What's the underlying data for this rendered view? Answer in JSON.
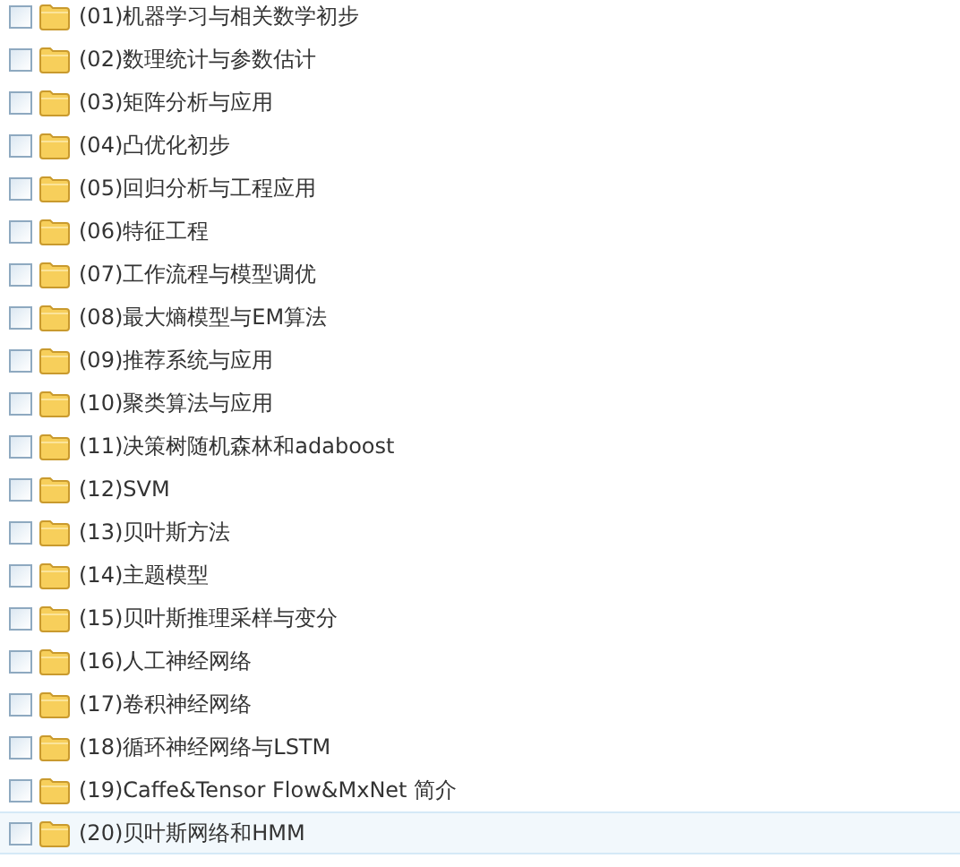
{
  "folders": [
    {
      "name": "(01)机器学习与相关数学初步",
      "highlighted": false
    },
    {
      "name": "(02)数理统计与参数估计",
      "highlighted": false
    },
    {
      "name": "(03)矩阵分析与应用",
      "highlighted": false
    },
    {
      "name": "(04)凸优化初步",
      "highlighted": false
    },
    {
      "name": "(05)回归分析与工程应用",
      "highlighted": false
    },
    {
      "name": "(06)特征工程",
      "highlighted": false
    },
    {
      "name": "(07)工作流程与模型调优",
      "highlighted": false
    },
    {
      "name": "(08)最大熵模型与EM算法",
      "highlighted": false
    },
    {
      "name": "(09)推荐系统与应用",
      "highlighted": false
    },
    {
      "name": "(10)聚类算法与应用",
      "highlighted": false
    },
    {
      "name": "(11)决策树随机森林和adaboost",
      "highlighted": false
    },
    {
      "name": "(12)SVM",
      "highlighted": false
    },
    {
      "name": "(13)贝叶斯方法",
      "highlighted": false
    },
    {
      "name": "(14)主题模型",
      "highlighted": false
    },
    {
      "name": "(15)贝叶斯推理采样与变分",
      "highlighted": false
    },
    {
      "name": "(16)人工神经网络",
      "highlighted": false
    },
    {
      "name": "(17)卷积神经网络",
      "highlighted": false
    },
    {
      "name": "(18)循环神经网络与LSTM",
      "highlighted": false
    },
    {
      "name": "(19)Caffe&Tensor Flow&MxNet 简介",
      "highlighted": false
    },
    {
      "name": "(20)贝叶斯网络和HMM",
      "highlighted": true
    }
  ]
}
